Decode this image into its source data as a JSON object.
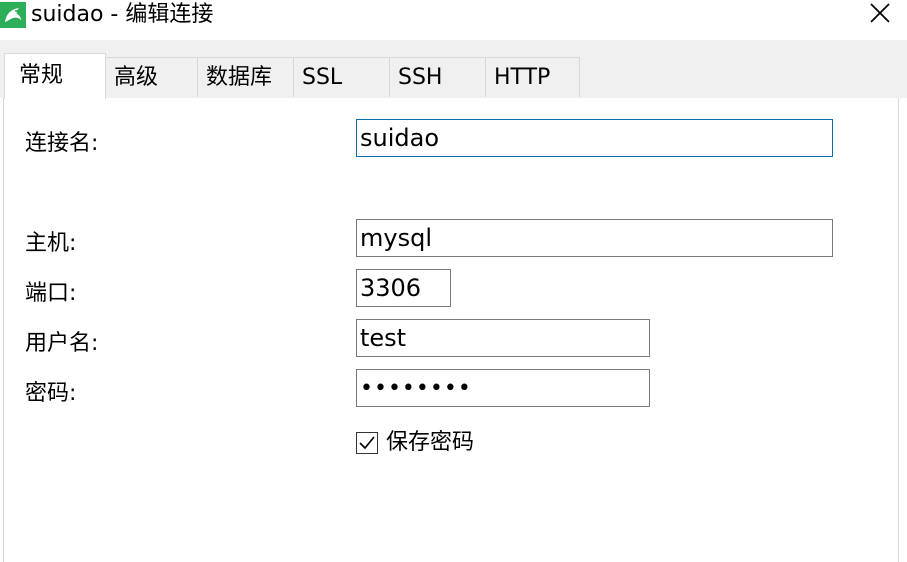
{
  "window": {
    "title": "suidao - 编辑连接",
    "app_icon": "dolphin-icon",
    "close_icon": "close-icon"
  },
  "tabs": [
    {
      "label": "常规",
      "active": true
    },
    {
      "label": "高级",
      "active": false
    },
    {
      "label": "数据库",
      "active": false
    },
    {
      "label": "SSL",
      "active": false
    },
    {
      "label": "SSH",
      "active": false
    },
    {
      "label": "HTTP",
      "active": false
    }
  ],
  "form": {
    "connection_name": {
      "label": "连接名:",
      "value": "suidao"
    },
    "host": {
      "label": "主机:",
      "value": "mysql"
    },
    "port": {
      "label": "端口:",
      "value": "3306"
    },
    "username": {
      "label": "用户名:",
      "value": "test"
    },
    "password": {
      "label": "密码:",
      "value": "testtest"
    },
    "save_password": {
      "label": "保存密码",
      "checked": true
    }
  },
  "colors": {
    "accent": "#2fae5a",
    "focus_border": "#0a6fb0",
    "tab_bg": "#f0f0f0"
  }
}
